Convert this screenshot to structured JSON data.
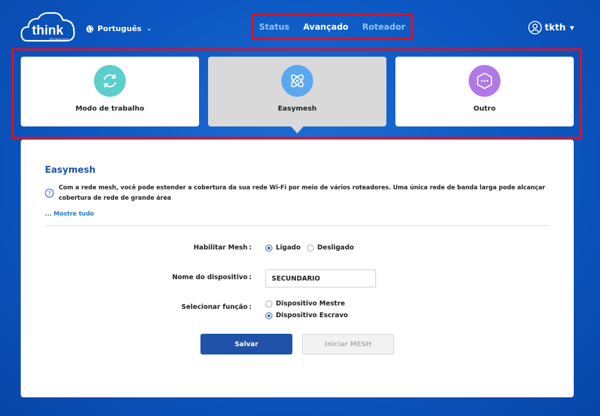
{
  "header": {
    "logo_text": "think",
    "logo_sub": "TECHNOLOGY",
    "language": "Português",
    "nav": [
      {
        "label": "Status",
        "active": false
      },
      {
        "label": "Avançado",
        "active": true
      },
      {
        "label": "Roteador",
        "active": false
      }
    ],
    "user": "tkth"
  },
  "cards": [
    {
      "label": "Modo de trabalho",
      "icon": "refresh-icon",
      "color": "#5ccfcc",
      "selected": false
    },
    {
      "label": "Easymesh",
      "icon": "atom-icon",
      "color": "#5aa8f0",
      "selected": true
    },
    {
      "label": "Outro",
      "icon": "hexagon-dots-icon",
      "color": "#b278e8",
      "selected": false
    }
  ],
  "panel": {
    "title": "Easymesh",
    "description": "Com a rede mesh, você pode estender a cobertura da sua rede Wi-Fi por meio de vários roteadores. Uma única rede de banda larga pode alcançar cobertura de rede de grande área",
    "show_all": "... Mostre tudo",
    "mesh_label": "Habilitar Mesh",
    "mesh_on": "Ligado",
    "mesh_off": "Desligado",
    "mesh_enabled": true,
    "device_name_label": "Nome do dispositivo",
    "device_name_value": "SECUNDARIO",
    "role_label": "Selecionar função",
    "role_master": "Dispositivo Mestre",
    "role_slave": "Dispositivo Escravo",
    "role_selected": "slave",
    "colon": ":",
    "save_label": "Salvar",
    "start_mesh_label": "Iniciar MESH"
  },
  "colors": {
    "accent": "#1f52a8",
    "highlight_border": "#e0101e",
    "background": "#0b56c2"
  }
}
